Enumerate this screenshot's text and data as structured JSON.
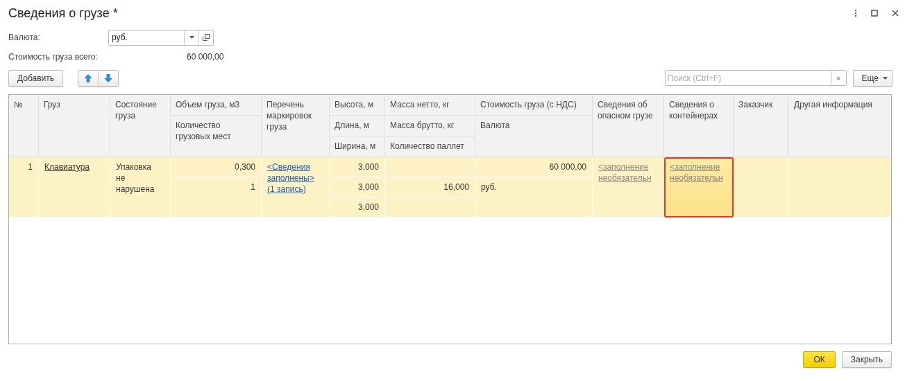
{
  "window": {
    "title": "Сведения о грузе *"
  },
  "currency": {
    "label": "Валюта:",
    "value": "руб."
  },
  "total": {
    "label": "Стоимость груза всего:",
    "value": "60 000,00"
  },
  "toolbar": {
    "add_button": "Добавить",
    "search": {
      "placeholder": "Поиск (Ctrl+F)",
      "clear": "×"
    },
    "more_button": "Еще"
  },
  "table": {
    "columns": [
      {
        "headers": [
          "№"
        ]
      },
      {
        "headers": [
          "Груз"
        ]
      },
      {
        "headers": [
          "Состояние груза"
        ]
      },
      {
        "headers": [
          "Объем груза, м3",
          "Количество грузовых мест"
        ]
      },
      {
        "headers": [
          "Перечень маркировок груза"
        ]
      },
      {
        "headers": [
          "Высота, м",
          "Длина, м",
          "Ширина, м"
        ]
      },
      {
        "headers": [
          "Масса нетто, кг",
          "Масса брутто, кг",
          "Количество паллет"
        ]
      },
      {
        "headers": [
          "Стоимость груза (с НДС)",
          "Валюта"
        ]
      },
      {
        "headers": [
          "Сведения об опасном грузе"
        ]
      },
      {
        "headers": [
          "Сведения о контейнерах"
        ]
      },
      {
        "headers": [
          "Заказчик"
        ]
      },
      {
        "headers": [
          "Другая информация"
        ]
      }
    ],
    "rows": [
      {
        "selected": true,
        "cells": [
          {
            "selected": false,
            "parts": [
              {
                "kind": "number",
                "text": "1"
              }
            ]
          },
          {
            "selected": false,
            "parts": [
              {
                "kind": "link",
                "text": "Клавиатура"
              }
            ]
          },
          {
            "selected": false,
            "parts": [
              {
                "kind": "text",
                "text": "Упаковка не нарушена"
              }
            ]
          },
          {
            "selected": false,
            "parts": [
              {
                "kind": "number",
                "text": "0,300"
              },
              {
                "kind": "number",
                "text": "1"
              }
            ]
          },
          {
            "selected": false,
            "parts": [
              {
                "kind": "hyperlink",
                "text": "<Сведения заполнены> (1 запись)"
              }
            ]
          },
          {
            "selected": false,
            "parts": [
              {
                "kind": "number",
                "text": "3,000"
              },
              {
                "kind": "number",
                "text": "3,000"
              },
              {
                "kind": "number",
                "text": "3,000"
              }
            ]
          },
          {
            "selected": false,
            "parts": [
              {
                "kind": "blank"
              },
              {
                "kind": "number",
                "text": "16,000"
              },
              {
                "kind": "blank"
              }
            ]
          },
          {
            "selected": false,
            "parts": [
              {
                "kind": "number",
                "text": "60 000,00"
              },
              {
                "kind": "text",
                "text": "руб."
              }
            ]
          },
          {
            "selected": false,
            "parts": [
              {
                "kind": "optional",
                "text": "<заполнение необязательн"
              }
            ]
          },
          {
            "selected": true,
            "parts": [
              {
                "kind": "optional",
                "text": "<заполнение необязательн"
              }
            ]
          },
          {
            "selected": false,
            "parts": [
              {
                "kind": "blank"
              }
            ]
          },
          {
            "selected": false,
            "parts": [
              {
                "kind": "blank"
              }
            ]
          }
        ]
      }
    ]
  },
  "buttons": {
    "ok": "ОК",
    "close": "Закрыть"
  }
}
